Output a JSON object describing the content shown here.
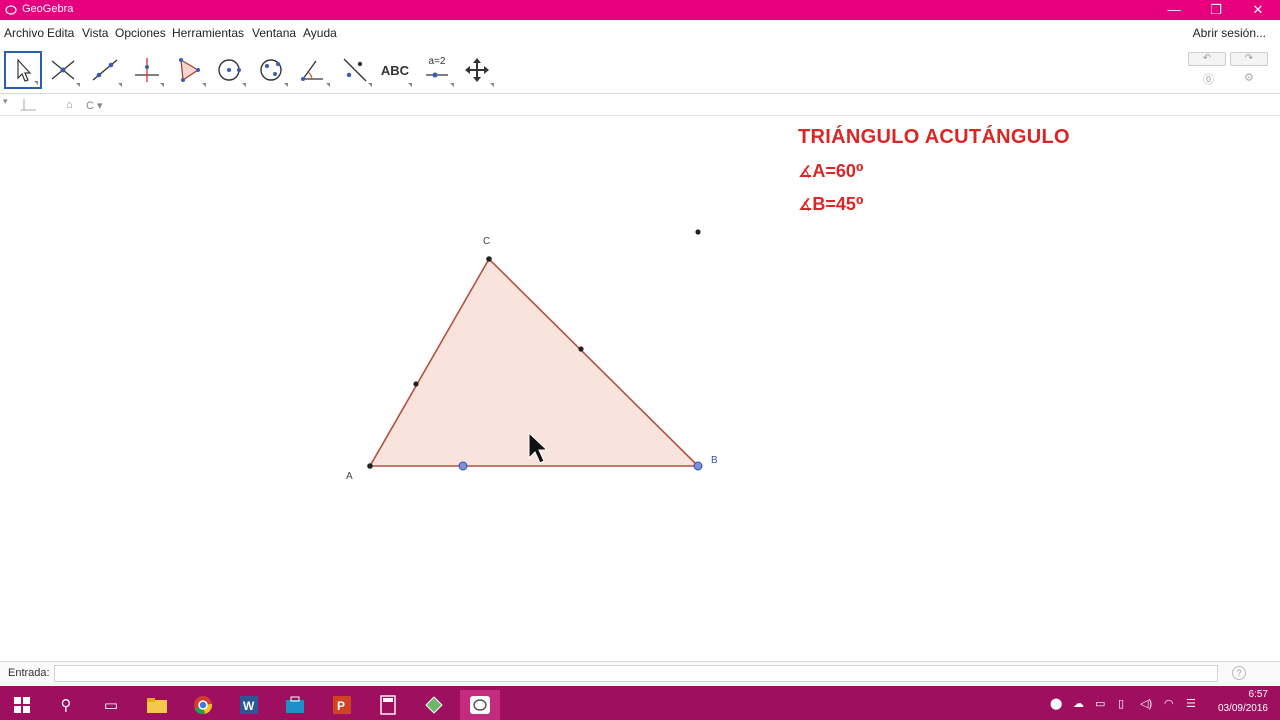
{
  "window": {
    "title": "GeoGebra",
    "minimize": "—",
    "maximize": "❐",
    "close": "✕"
  },
  "menu": {
    "items": [
      "Archivo",
      "Edita",
      "Vista",
      "Opciones",
      "Herramientas",
      "Ventana",
      "Ayuda"
    ],
    "signin": "Abrir sesión..."
  },
  "toolbar": {
    "tools": [
      "move",
      "point",
      "line",
      "perpendicular",
      "polygon",
      "circle",
      "conic",
      "angle",
      "reflect",
      "text",
      "slider",
      "move-graphics"
    ],
    "text_tool_label": "ABC",
    "slider_tool_label": "a=2",
    "undo": "↶",
    "redo": "↷"
  },
  "graphics_header": {
    "home": "⌂",
    "style": "C ▾"
  },
  "construction": {
    "labels": {
      "A": "A",
      "B": "B",
      "C": "C"
    },
    "fill_color": "#f9e3dd",
    "stroke_color": "#b5503c"
  },
  "info": {
    "title": "TRIÁNGULO ACUTÁNGULO",
    "angle_symbol": "∡",
    "angle_a": "A=60⁰",
    "angle_b": "B=45⁰",
    "color": "#dc2626"
  },
  "input_bar": {
    "label": "Entrada:",
    "value": ""
  },
  "taskbar": {
    "time": "6:57",
    "date": "03/09/2016"
  }
}
